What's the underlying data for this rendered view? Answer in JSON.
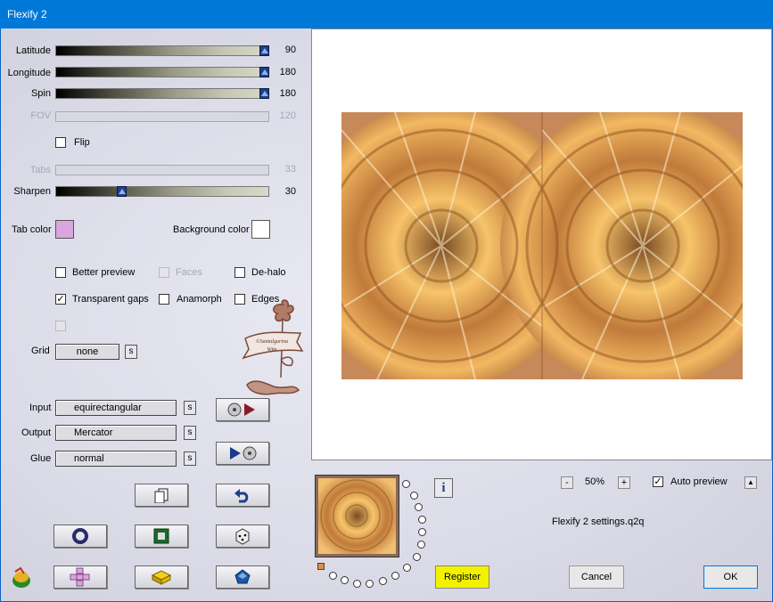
{
  "window": {
    "title": "Flexify 2"
  },
  "sliders": [
    {
      "name": "latitude",
      "label": "Latitude",
      "value": "90",
      "fraction": 1.0,
      "enabled": true
    },
    {
      "name": "longitude",
      "label": "Longitude",
      "value": "180",
      "fraction": 1.0,
      "enabled": true
    },
    {
      "name": "spin",
      "label": "Spin",
      "value": "180",
      "fraction": 1.0,
      "enabled": true
    },
    {
      "name": "fov",
      "label": "FOV",
      "value": "120",
      "fraction": 0.0,
      "enabled": false
    },
    {
      "name": "tabs",
      "label": "Tabs",
      "value": "33",
      "fraction": 0.0,
      "enabled": false
    },
    {
      "name": "sharpen",
      "label": "Sharpen",
      "value": "30",
      "fraction": 0.3,
      "enabled": true
    }
  ],
  "flip": {
    "label": "Flip",
    "checked": false
  },
  "colors": {
    "tab_label": "Tab color",
    "tab_color": "#d9a6dd",
    "background_label": "Background color",
    "background_color": "#ffffff"
  },
  "options": {
    "better_preview": {
      "label": "Better preview",
      "checked": false
    },
    "faces": {
      "label": "Faces",
      "checked": false
    },
    "de_halo": {
      "label": "De-halo",
      "checked": false
    },
    "transparent_gaps": {
      "label": "Transparent gaps",
      "checked": true,
      "mark": "✓"
    },
    "anamorph": {
      "label": "Anamorph",
      "checked": false
    },
    "edges": {
      "label": "Edges",
      "checked": false
    }
  },
  "grid": {
    "label": "Grid",
    "value": "none",
    "s": "s"
  },
  "projection": {
    "input_label": "Input",
    "input_value": "equirectangular",
    "output_label": "Output",
    "output_value": "Mercator",
    "glue_label": "Glue",
    "glue_value": "normal",
    "s": "s"
  },
  "watermark": {
    "line1": "©Santalgarina",
    "line2": "Wim"
  },
  "zoom": {
    "minus": "-",
    "value": "50%",
    "plus": "+"
  },
  "auto_preview": {
    "label": "Auto preview",
    "checked": true,
    "mark": "✓",
    "collapse": "▲"
  },
  "info": {
    "icon": "i"
  },
  "settings_file": "Flexify 2 settings.q2q",
  "buttons": {
    "register": "Register",
    "cancel": "Cancel",
    "ok": "OK"
  },
  "accent": {
    "register_bg": "#f2f200",
    "titlebar": "#0078d7"
  }
}
